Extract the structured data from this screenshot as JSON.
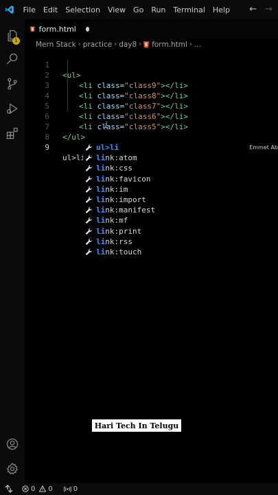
{
  "menu": {
    "items": [
      "File",
      "Edit",
      "Selection",
      "View",
      "Go",
      "Run",
      "Terminal",
      "Help"
    ]
  },
  "activity_bar": {
    "explorer_badge": "1"
  },
  "tab": {
    "label": "form.html"
  },
  "breadcrumb": {
    "items": [
      "Mern Stack",
      "practice",
      "day8",
      "form.html",
      "..."
    ]
  },
  "editor": {
    "lines": [
      {
        "num": "1",
        "tag_open": "<ul>"
      },
      {
        "num": "2",
        "tag_open": "<li ",
        "attr": "class",
        "eq": "=",
        "value": "\"class9\"",
        "tag_close": "></li>"
      },
      {
        "num": "3",
        "tag_open": "<li ",
        "attr": "class",
        "eq": "=",
        "value": "\"class8\"",
        "tag_close": "></li>"
      },
      {
        "num": "4",
        "tag_open": "<li ",
        "attr": "class",
        "eq": "=",
        "value": "\"class7\"",
        "tag_close": "></li>"
      },
      {
        "num": "5",
        "tag_open": "<li ",
        "attr": "class",
        "eq": "=",
        "value": "\"class6\"",
        "tag_close": "></li>"
      },
      {
        "num": "6",
        "tag_open": "<li ",
        "attr": "class",
        "eq": "=",
        "value": "\"class5\"",
        "tag_close": "></li>"
      },
      {
        "num": "7",
        "tag_open": "</ul>"
      },
      {
        "num": "8",
        "text": ""
      },
      {
        "num": "9",
        "text": "ul>li"
      }
    ],
    "active_line": "9"
  },
  "suggestions": {
    "detail": "Emmet Ab",
    "items": [
      {
        "hl": "ul>li",
        "rest": ""
      },
      {
        "hl": "li",
        "rest": "nk:atom"
      },
      {
        "hl": "li",
        "rest": "nk:css"
      },
      {
        "hl": "li",
        "rest": "nk:favicon"
      },
      {
        "hl": "li",
        "rest": "nk:im"
      },
      {
        "hl": "li",
        "rest": "nk:import"
      },
      {
        "hl": "li",
        "rest": "nk:manifest"
      },
      {
        "hl": "li",
        "rest": "nk:mf"
      },
      {
        "hl": "li",
        "rest": "nk:print"
      },
      {
        "hl": "li",
        "rest": "nk:rss"
      },
      {
        "hl": "li",
        "rest": "nk:touch"
      }
    ]
  },
  "watermark": {
    "text": "Hari Tech In Telugu"
  },
  "status": {
    "errors": "0",
    "warnings": "0",
    "ports": "0"
  },
  "colors": {
    "accent": "#3794ff",
    "tag": "#73cf9b",
    "attribute": "#9cdcfe",
    "string": "#ce9178",
    "badge": "#cca700"
  }
}
